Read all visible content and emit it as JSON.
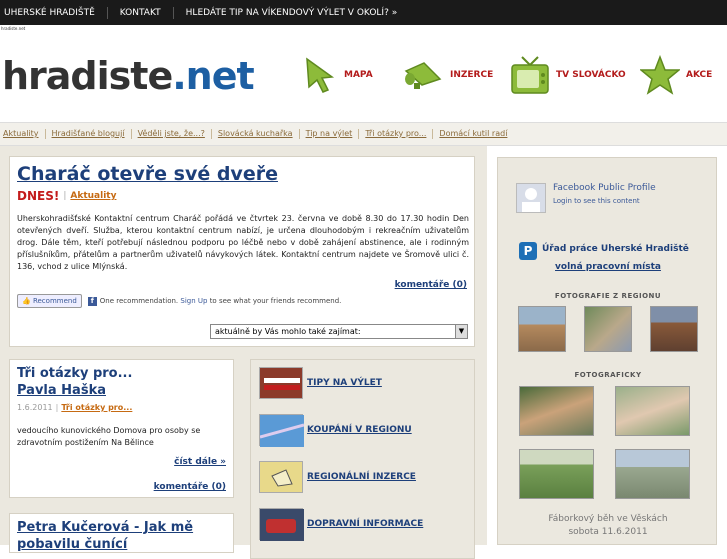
{
  "topbar": {
    "items": [
      "UHERSKÉ HRADIŠTĚ",
      "KONTAKT",
      "HLEDÁTE TIP NA VÍKENDOVÝ VÝLET V OKOLÍ? »"
    ]
  },
  "tiny_label": "hradiste.net",
  "logo": {
    "main": "hradiste",
    "dot": ".",
    "tld": "net"
  },
  "nav_icons": [
    {
      "label": "MAPA",
      "icon": "cursor-arrow-icon"
    },
    {
      "label": "INZERCE",
      "icon": "megaphone-icon"
    },
    {
      "label": "TV SLOVÁCKO",
      "icon": "tv-icon"
    },
    {
      "label": "AKCE",
      "icon": "star-icon"
    }
  ],
  "subnav": [
    "Aktuality",
    "Hradišťané blogují",
    "Věděli jste, že...?",
    "Slovácká kuchařka",
    "Tip na výlet",
    "Tři otázky pro...",
    "Domácí kutil radí"
  ],
  "headline": {
    "title": "Charáč otevře své dveře",
    "tag": "DNES!",
    "category": "Aktuality",
    "body": "Uherskohradišťské Kontaktní centrum Charáč pořádá ve čtvrtek 23. června ve době 8.30 do 17.30 hodin Den otevřených dveří. Služba, kterou kontaktní centrum nabízí, je určena dlouhodobým i rekreačním uživatelům drog. Dále těm, kteří potřebují následnou podporu po léčbě nebo v době zahájení abstinence, ale i rodinným příslušníkům, přátelům a partnerům uživatelů návykových látek. Kontaktní centrum najdete ve Šromově ulici č. 136, vchod z ulice Mlýnská.",
    "comments": "komentáře (0)",
    "fb_button": "Recommend",
    "fb_text": "One recommendation.",
    "fb_signup": "Sign Up",
    "fb_rest": "to see what your friends recommend.",
    "select": "aktuálně by Vás mohlo také zajímat:"
  },
  "card2": {
    "kicker": "Tři otázky pro...",
    "name": "Pavla Haška",
    "date": "1.6.2011",
    "category": "Tři otázky pro...",
    "body": "vedoucího kunovického Domova pro osoby se zdravotním postižením Na Bělince",
    "more": "číst dále »",
    "comments": "komentáře (0)"
  },
  "card3": {
    "title_line1": "Petra Kučerová - Jak mě",
    "title_line2": "pobavilu čunící"
  },
  "midlist": [
    {
      "label": "TIPY NA VÝLET",
      "thumb_color": "#8b3a2a"
    },
    {
      "label": "KOUPÁNÍ V REGIONU",
      "thumb_color": "#3a7bbf"
    },
    {
      "label": "REGIONÁLNÍ INZERCE",
      "thumb_color": "#e8d98a"
    },
    {
      "label": "DOPRAVNÍ INFORMACE",
      "thumb_color": "#a23030"
    }
  ],
  "right": {
    "fb_profile": "Facebook Public Profile",
    "fb_login": "Login to see this content",
    "urad": "Úřad práce Uherské Hradiště",
    "volna": "volná pracovní místa",
    "foto_title": "FOTOGRAFIE Z REGIONU",
    "fotograficky_title": "FOTOGRAFICKY",
    "caption1": "Fáborkový běh ve Věskách",
    "caption2": "sobota 11.6.2011"
  },
  "colors": {
    "topbar": "#1a1a1a",
    "link_blue": "#1d3f7a",
    "accent_red": "#b31b1b",
    "accent_orange": "#c66a12",
    "panel_bg": "#ebe8df"
  }
}
